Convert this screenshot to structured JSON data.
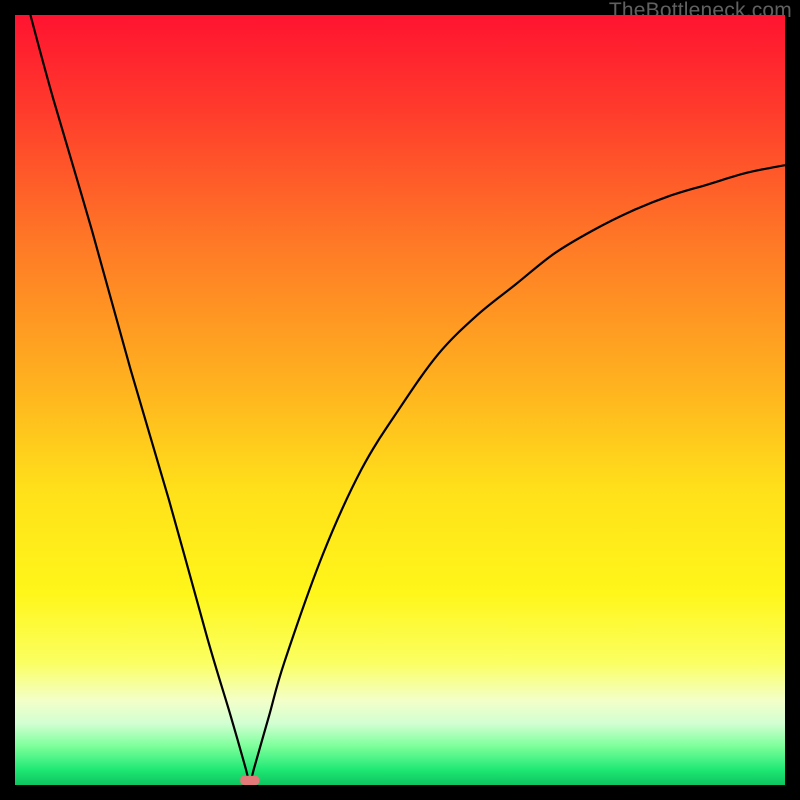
{
  "watermark": "TheBottleneck.com",
  "chart_data": {
    "type": "line",
    "title": "",
    "xlabel": "",
    "ylabel": "",
    "xlim": [
      0,
      100
    ],
    "ylim": [
      0,
      100
    ],
    "grid": false,
    "series": [
      {
        "name": "curve",
        "x": [
          2,
          5,
          10,
          15,
          20,
          25,
          28,
          30,
          30.5,
          31,
          33,
          35,
          40,
          45,
          50,
          55,
          60,
          65,
          70,
          75,
          80,
          85,
          90,
          95,
          100
        ],
        "values": [
          100,
          89,
          72,
          54,
          37,
          19,
          9,
          2,
          0,
          2,
          9,
          16,
          30,
          41,
          49,
          56,
          61,
          65,
          69,
          72,
          74.5,
          76.5,
          78,
          79.5,
          80.5
        ]
      }
    ],
    "marker": {
      "x": 30.5,
      "width": 2.5,
      "height": 1.2,
      "color": "#e27a7a"
    },
    "gradient_stops": [
      {
        "offset": 0,
        "color": "#ff1330"
      },
      {
        "offset": 12,
        "color": "#ff3a2c"
      },
      {
        "offset": 30,
        "color": "#ff7a26"
      },
      {
        "offset": 48,
        "color": "#ffb21f"
      },
      {
        "offset": 62,
        "color": "#ffe11a"
      },
      {
        "offset": 75,
        "color": "#fff61a"
      },
      {
        "offset": 84,
        "color": "#fbff60"
      },
      {
        "offset": 89,
        "color": "#f3ffc8"
      },
      {
        "offset": 92,
        "color": "#d2ffd2"
      },
      {
        "offset": 95,
        "color": "#7cff9a"
      },
      {
        "offset": 98,
        "color": "#1fe874"
      },
      {
        "offset": 100,
        "color": "#0dc45f"
      }
    ]
  }
}
